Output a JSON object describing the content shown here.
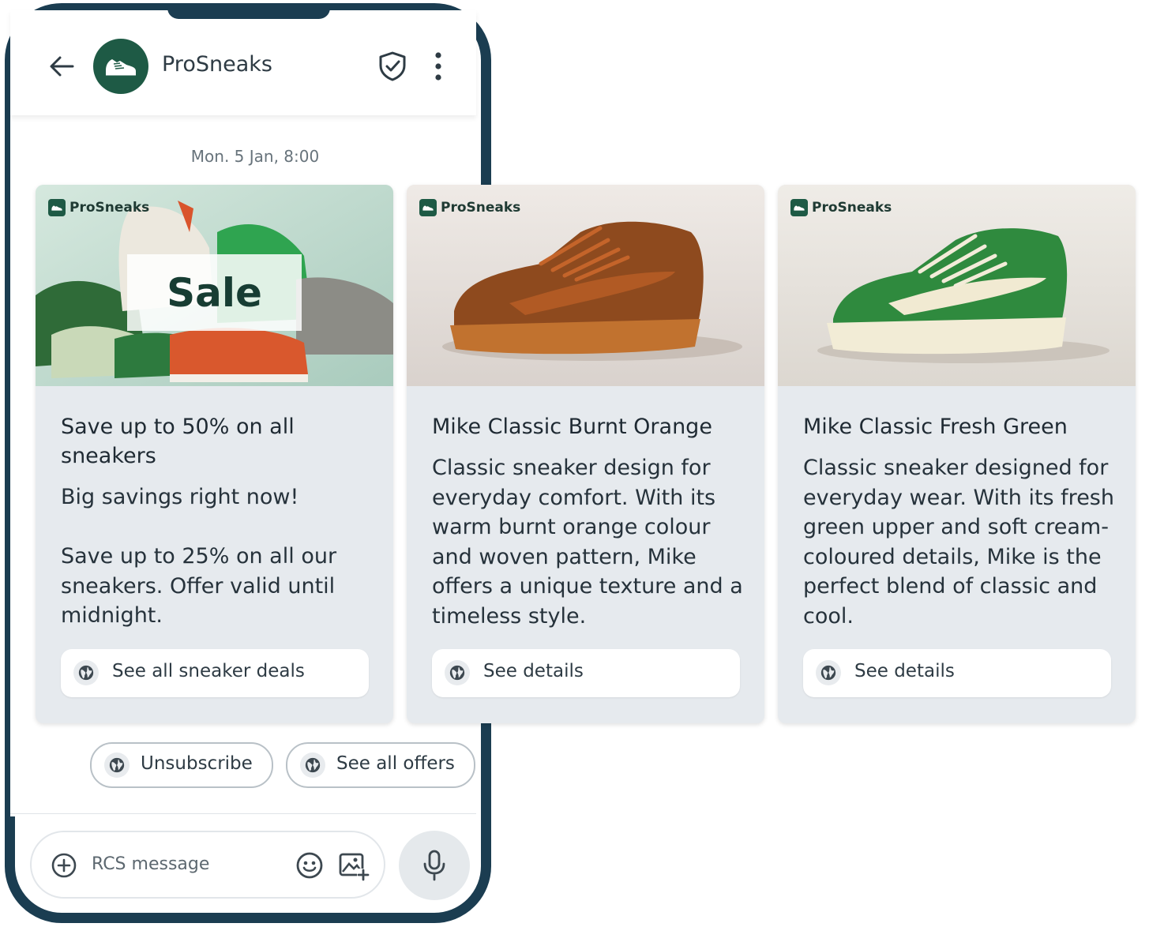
{
  "header": {
    "brand_name": "ProSneaks"
  },
  "timestamp": "Mon. 5 Jan, 8:00",
  "cards": [
    {
      "brand_chip": "ProSneaks",
      "image_overlay": "Sale",
      "title": "Save up to 50% on all sneakers",
      "description": "Big savings right now!\n\nSave up to 25% on all our sneakers. Offer valid until midnight.",
      "button_label": "See all sneaker deals"
    },
    {
      "brand_chip": "ProSneaks",
      "title": "Mike Classic Burnt Orange",
      "description": "Classic sneaker design for everyday comfort. With its warm burnt orange colour and woven pattern, Mike offers a unique texture and a timeless style.",
      "button_label": "See details"
    },
    {
      "brand_chip": "ProSneaks",
      "title": "Mike Classic Fresh Green",
      "description": "Classic sneaker designed for everyday wear. With its fresh green upper and soft cream-coloured details, Mike is the perfect blend of classic and cool.",
      "button_label": "See details"
    }
  ],
  "suggestions": [
    {
      "label": "Unsubscribe"
    },
    {
      "label": "See all offers"
    }
  ],
  "composer": {
    "placeholder": "RCS message"
  },
  "colors": {
    "brand_green": "#1e5a45",
    "frame": "#1b3d51",
    "card_bg": "#e6eaee"
  },
  "icons": [
    "back-arrow-icon",
    "sneaker-logo-icon",
    "shield-check-icon",
    "more-vertical-icon",
    "globe-icon",
    "add-circle-icon",
    "emoji-icon",
    "add-image-icon",
    "microphone-icon"
  ]
}
